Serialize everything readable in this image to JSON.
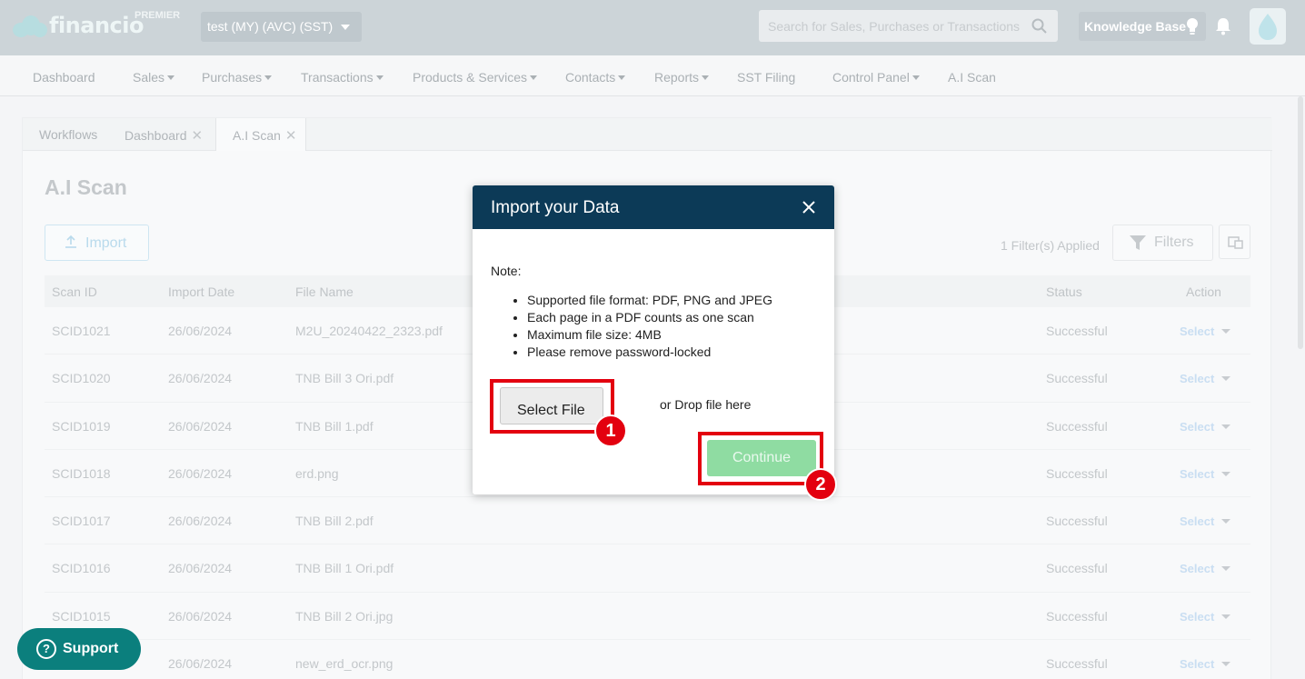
{
  "header": {
    "brand": "financio",
    "tier": "PREMIER",
    "organization": "test (MY) (AVC) (SST)",
    "search_placeholder": "Search for Sales, Purchases or Transactions",
    "knowledge_base": "Knowledge Base"
  },
  "nav": [
    "Dashboard",
    "Sales",
    "Purchases",
    "Transactions",
    "Products & Services",
    "Contacts",
    "Reports",
    "SST Filing",
    "Control Panel",
    "A.I Scan"
  ],
  "tabs": [
    {
      "label": "Workflows"
    },
    {
      "label": "Dashboard"
    },
    {
      "label": "A.I Scan"
    }
  ],
  "page": {
    "title": "A.I Scan",
    "import_label": "Import",
    "filters_applied": "1 Filter(s) Applied",
    "filters_label": "Filters"
  },
  "table": {
    "columns": [
      "Scan ID",
      "Import Date",
      "File Name",
      "Status",
      "Action"
    ],
    "rows": [
      {
        "id": "SCID1021",
        "date": "26/06/2024",
        "file": "M2U_20240422_2323.pdf",
        "status": "Successful",
        "action": "Select"
      },
      {
        "id": "SCID1020",
        "date": "26/06/2024",
        "file": "TNB Bill 3 Ori.pdf",
        "status": "Successful",
        "action": "Select"
      },
      {
        "id": "SCID1019",
        "date": "26/06/2024",
        "file": "TNB Bill 1.pdf",
        "status": "Successful",
        "action": "Select"
      },
      {
        "id": "SCID1018",
        "date": "26/06/2024",
        "file": "erd.png",
        "status": "Successful",
        "action": "Select"
      },
      {
        "id": "SCID1017",
        "date": "26/06/2024",
        "file": "TNB Bill 2.pdf",
        "status": "Successful",
        "action": "Select"
      },
      {
        "id": "SCID1016",
        "date": "26/06/2024",
        "file": "TNB Bill 1 Ori.pdf",
        "status": "Successful",
        "action": "Select"
      },
      {
        "id": "SCID1015",
        "date": "26/06/2024",
        "file": "TNB Bill 2 Ori.jpg",
        "status": "Successful",
        "action": "Select"
      },
      {
        "id": "",
        "date": "26/06/2024",
        "file": "new_erd_ocr.png",
        "status": "Successful",
        "action": "Select"
      }
    ]
  },
  "support": {
    "label": "Support"
  },
  "modal": {
    "title": "Import your Data",
    "note_label": "Note:",
    "notes": [
      "Supported file format: PDF, PNG and JPEG",
      "Each page in a PDF counts as one scan",
      "Maximum file size: 4MB",
      "Please remove password-locked"
    ],
    "select_file_label": "Select File",
    "drop_text": "or Drop file here",
    "continue_label": "Continue"
  },
  "annotations": [
    {
      "number": "1"
    },
    {
      "number": "2"
    }
  ],
  "colors": {
    "modal_header": "#0c3a57",
    "continue_disabled": "#8fdca2",
    "support": "#0b7f7d",
    "annotation": "#e3000f"
  }
}
